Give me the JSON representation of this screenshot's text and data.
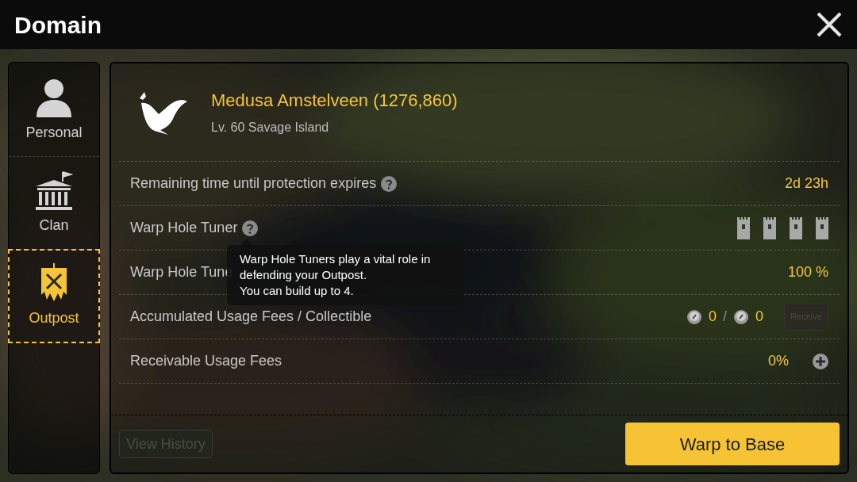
{
  "window": {
    "title": "Domain"
  },
  "sidebar": {
    "items": [
      {
        "label": "Personal",
        "kind": "person",
        "selected": false
      },
      {
        "label": "Clan",
        "kind": "hall",
        "selected": false
      },
      {
        "label": "Outpost",
        "kind": "banner",
        "selected": true
      }
    ]
  },
  "outpost": {
    "name": "Medusa Amstelveen (1276,860)",
    "subtitle": "Lv. 60 Savage Island"
  },
  "rows": [
    {
      "label": "Remaining time until protection expires",
      "help": true,
      "kind": "text",
      "value": "2d 23h"
    },
    {
      "label": "Warp Hole Tuner",
      "help": true,
      "kind": "towers",
      "towers": [
        {
          "kind": "tower"
        },
        {
          "kind": "tower"
        },
        {
          "kind": "tower"
        },
        {
          "kind": "tower"
        }
      ]
    },
    {
      "label": "Warp Hole Tune",
      "help": false,
      "kind": "text",
      "value": "100 %"
    },
    {
      "label": "Accumulated Usage Fees / Collectible",
      "help": false,
      "kind": "fees",
      "accumulated": "0",
      "separator": "/",
      "collectible": "0",
      "button": {
        "label": "Receive",
        "disabled": true
      }
    },
    {
      "label": "Receivable Usage Fees",
      "help": false,
      "kind": "plus",
      "value": "0%"
    }
  ],
  "tooltip": {
    "lines": [
      "Warp Hole Tuners play a vital role in defending your Outpost.",
      "You can build up to 4."
    ]
  },
  "footer": {
    "history_button": {
      "label": "View History",
      "disabled": true
    },
    "warp_button": {
      "label": "Warp to Base",
      "disabled": false
    }
  }
}
